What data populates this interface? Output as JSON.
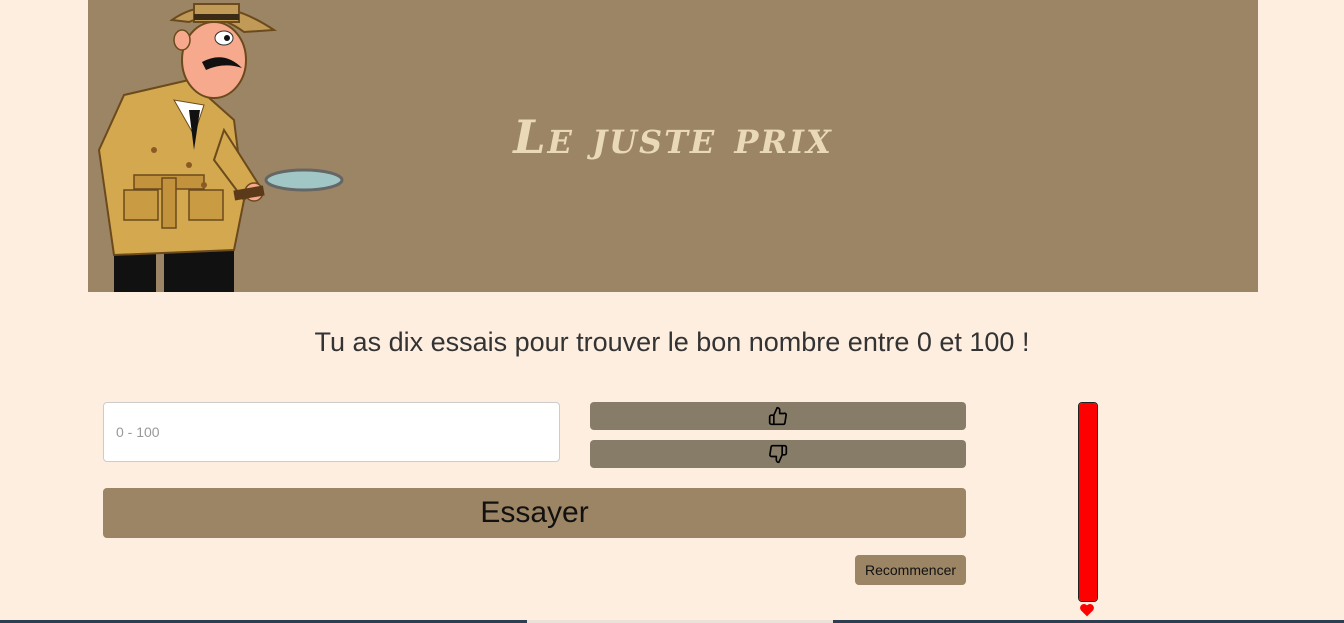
{
  "header": {
    "title": "Le juste prix",
    "mascot_icon": "detective-with-magnifier-icon"
  },
  "instructions": "Tu as dix essais pour trouver le bon nombre entre 0 et 100 !",
  "guess": {
    "value": "",
    "placeholder": "0 - 100"
  },
  "hints": {
    "higher_icon": "thumbs-up-icon",
    "lower_icon": "thumbs-down-icon"
  },
  "buttons": {
    "try_label": "Essayer",
    "restart_label": "Recommencer"
  },
  "lives": {
    "fraction_remaining": 1.0,
    "icon": "heart-icon"
  },
  "colors": {
    "background": "#fdeee0",
    "banner": "#9c8564",
    "hint_button": "#867c68",
    "life_bar": "#ff0000"
  }
}
